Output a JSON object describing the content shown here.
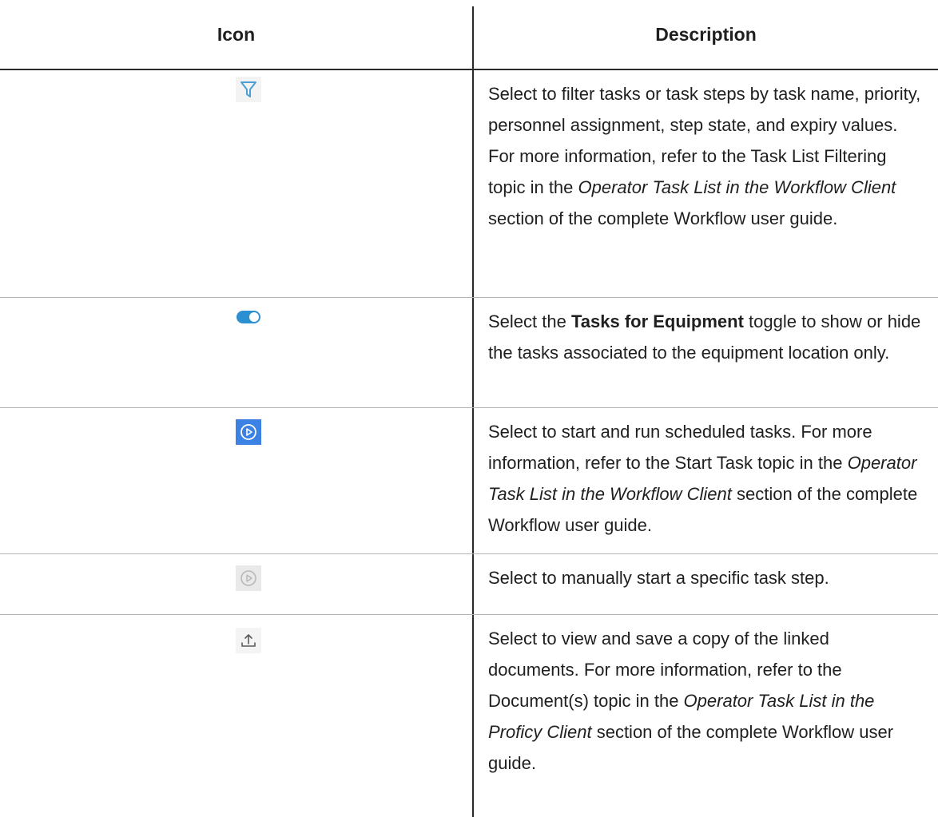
{
  "table": {
    "headers": {
      "icon": "Icon",
      "description": "Description"
    },
    "rows": [
      {
        "icon": "filter-icon",
        "parts": [
          {
            "t": "Select to filter tasks or task steps by task name, priority, personnel assignment, step state, and expiry values. For more information, refer to the Task List Filtering topic in the "
          },
          {
            "t": "Operator Task List in the Workflow Client",
            "em": true
          },
          {
            "t": " section of the com­plete Workflow user guide."
          }
        ]
      },
      {
        "icon": "toggle-icon",
        "parts": [
          {
            "t": "Select the "
          },
          {
            "t": "Tasks for Equipment",
            "strong": true
          },
          {
            "t": " toggle to show or hide the tasks associated to the equipment location only."
          }
        ]
      },
      {
        "icon": "start-task-icon",
        "parts": [
          {
            "t": "Select to start and run scheduled tasks. For more information, refer to the Start Task topic in the "
          },
          {
            "t": "Operator Task List in the Workflow Client",
            "em": true
          },
          {
            "t": " section of the complete Workflow user guide."
          }
        ]
      },
      {
        "icon": "start-step-icon",
        "parts": [
          {
            "t": "Select to manually start a specific task step."
          }
        ]
      },
      {
        "icon": "upload-icon",
        "parts": [
          {
            "t": "Select to view and save a copy of the linked documents. For more information, refer to the Document(s) topic in the "
          },
          {
            "t": "Operator Task List in the Proficy Client",
            "em": true
          },
          {
            "t": " section of the complete Work­flow user guide."
          }
        ]
      }
    ]
  },
  "colors": {
    "filter_icon": "#4a9fd6",
    "toggle_on": "#2b8fd1",
    "start_task_bg": "#3b82e4",
    "start_step_bg": "#e9e9e9",
    "upload_icon": "#5a5a5a"
  }
}
